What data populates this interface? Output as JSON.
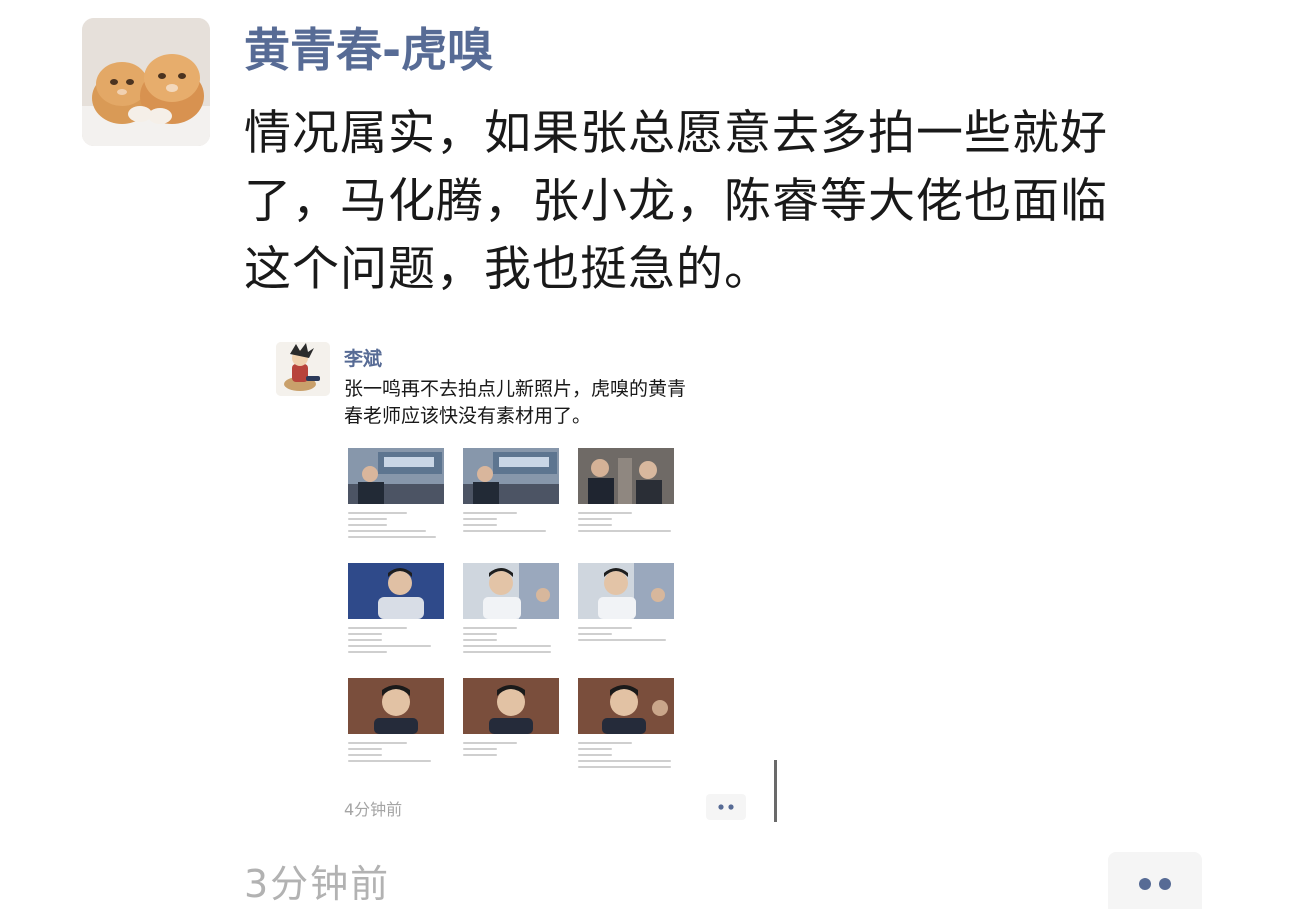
{
  "post": {
    "author_name": "黄青春-虎嗅",
    "avatar_icon": "two-cats-avatar",
    "text_lines": [
      "情况属实，如果张总愿意去多拍一些就好",
      "了，马化腾，张小龙，陈睿等大佬也面临",
      "这个问题，我也挺急的。"
    ],
    "timestamp": "3分钟前",
    "more_icon": "more-dots-icon"
  },
  "quoted": {
    "author_name": "李斌",
    "avatar_icon": "cartoon-character-avatar",
    "text_lines": [
      "张一鸣再不去拍点儿新照片，虎嗅的黄青",
      "春老师应该快没有素材用了。"
    ],
    "timestamp": "4分钟前",
    "grid_icons": [
      "article-thumbnail-icon",
      "article-thumbnail-icon",
      "article-thumbnail-icon",
      "article-thumbnail-icon",
      "article-thumbnail-icon",
      "article-thumbnail-icon",
      "article-thumbnail-icon",
      "article-thumbnail-icon",
      "article-thumbnail-icon"
    ]
  },
  "colors": {
    "name_blue": "#576b95",
    "body_text": "#191919",
    "time_gray": "#b2b2b2",
    "button_bg": "#f5f5f5"
  }
}
